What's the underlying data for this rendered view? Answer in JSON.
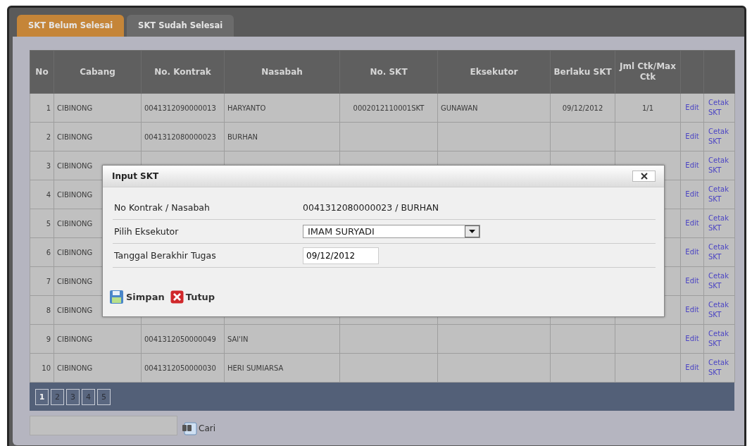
{
  "tabs": [
    {
      "label": "SKT Belum Selesai",
      "selected": true
    },
    {
      "label": "SKT Sudah Selesai",
      "selected": false
    }
  ],
  "table": {
    "columns": [
      "No",
      "Cabang",
      "No. Kontrak",
      "Nasabah",
      "No. SKT",
      "Eksekutor",
      "Berlaku SKT",
      "Jml Ctk/Max Ctk"
    ],
    "rows": [
      {
        "no": "1",
        "cabang": "CIBINONG",
        "kontrak": "0041312090000013",
        "nasabah": "HARYANTO",
        "no_skt": "0002012110001SKT",
        "eksekutor": "GUNAWAN",
        "berlaku": "09/12/2012",
        "jml": "1/1",
        "edit": "Edit",
        "cetak": "Cetak SKT"
      },
      {
        "no": "2",
        "cabang": "CIBINONG",
        "kontrak": "0041312080000023",
        "nasabah": "BURHAN",
        "edit": "Edit",
        "cetak": "Cetak SKT"
      },
      {
        "no": "3",
        "cabang": "CIBINONG",
        "edit": "Edit",
        "cetak": "Cetak SKT"
      },
      {
        "no": "4",
        "cabang": "CIBINONG",
        "edit": "Edit",
        "cetak": "Cetak SKT"
      },
      {
        "no": "5",
        "cabang": "CIBINONG",
        "edit": "Edit",
        "cetak": "Cetak SKT"
      },
      {
        "no": "6",
        "cabang": "CIBINONG",
        "edit": "Edit",
        "cetak": "Cetak SKT"
      },
      {
        "no": "7",
        "cabang": "CIBINONG",
        "edit": "Edit",
        "cetak": "Cetak SKT"
      },
      {
        "no": "8",
        "cabang": "CIBINONG",
        "edit": "Edit",
        "cetak": "Cetak SKT"
      },
      {
        "no": "9",
        "cabang": "CIBINONG",
        "kontrak": "0041312050000049",
        "nasabah": "SAI'IN",
        "edit": "Edit",
        "cetak": "Cetak SKT"
      },
      {
        "no": "10",
        "cabang": "CIBINONG",
        "kontrak": "0041312050000030",
        "nasabah": "HERI SUMIARSA",
        "edit": "Edit",
        "cetak": "Cetak SKT"
      }
    ]
  },
  "pager": [
    {
      "label": "1",
      "selected": true
    },
    {
      "label": "2",
      "selected": false
    },
    {
      "label": "3",
      "selected": false
    },
    {
      "label": "4",
      "selected": false
    },
    {
      "label": "5",
      "selected": false
    }
  ],
  "search": {
    "button": "Cari"
  },
  "dialog": {
    "title": "Input SKT",
    "fields": [
      {
        "kind": "text",
        "label": "No Kontrak / Nasabah",
        "value": "0041312080000023 / BURHAN"
      },
      {
        "kind": "select",
        "label": "Pilih Eksekutor",
        "value": "IMAM SURYADI"
      },
      {
        "kind": "input",
        "label": "Tanggal Berakhir Tugas",
        "value": "09/12/2012"
      }
    ],
    "buttons": [
      {
        "kind": "save",
        "label": "Simpan"
      },
      {
        "kind": "close",
        "label": "Tutup"
      }
    ]
  }
}
